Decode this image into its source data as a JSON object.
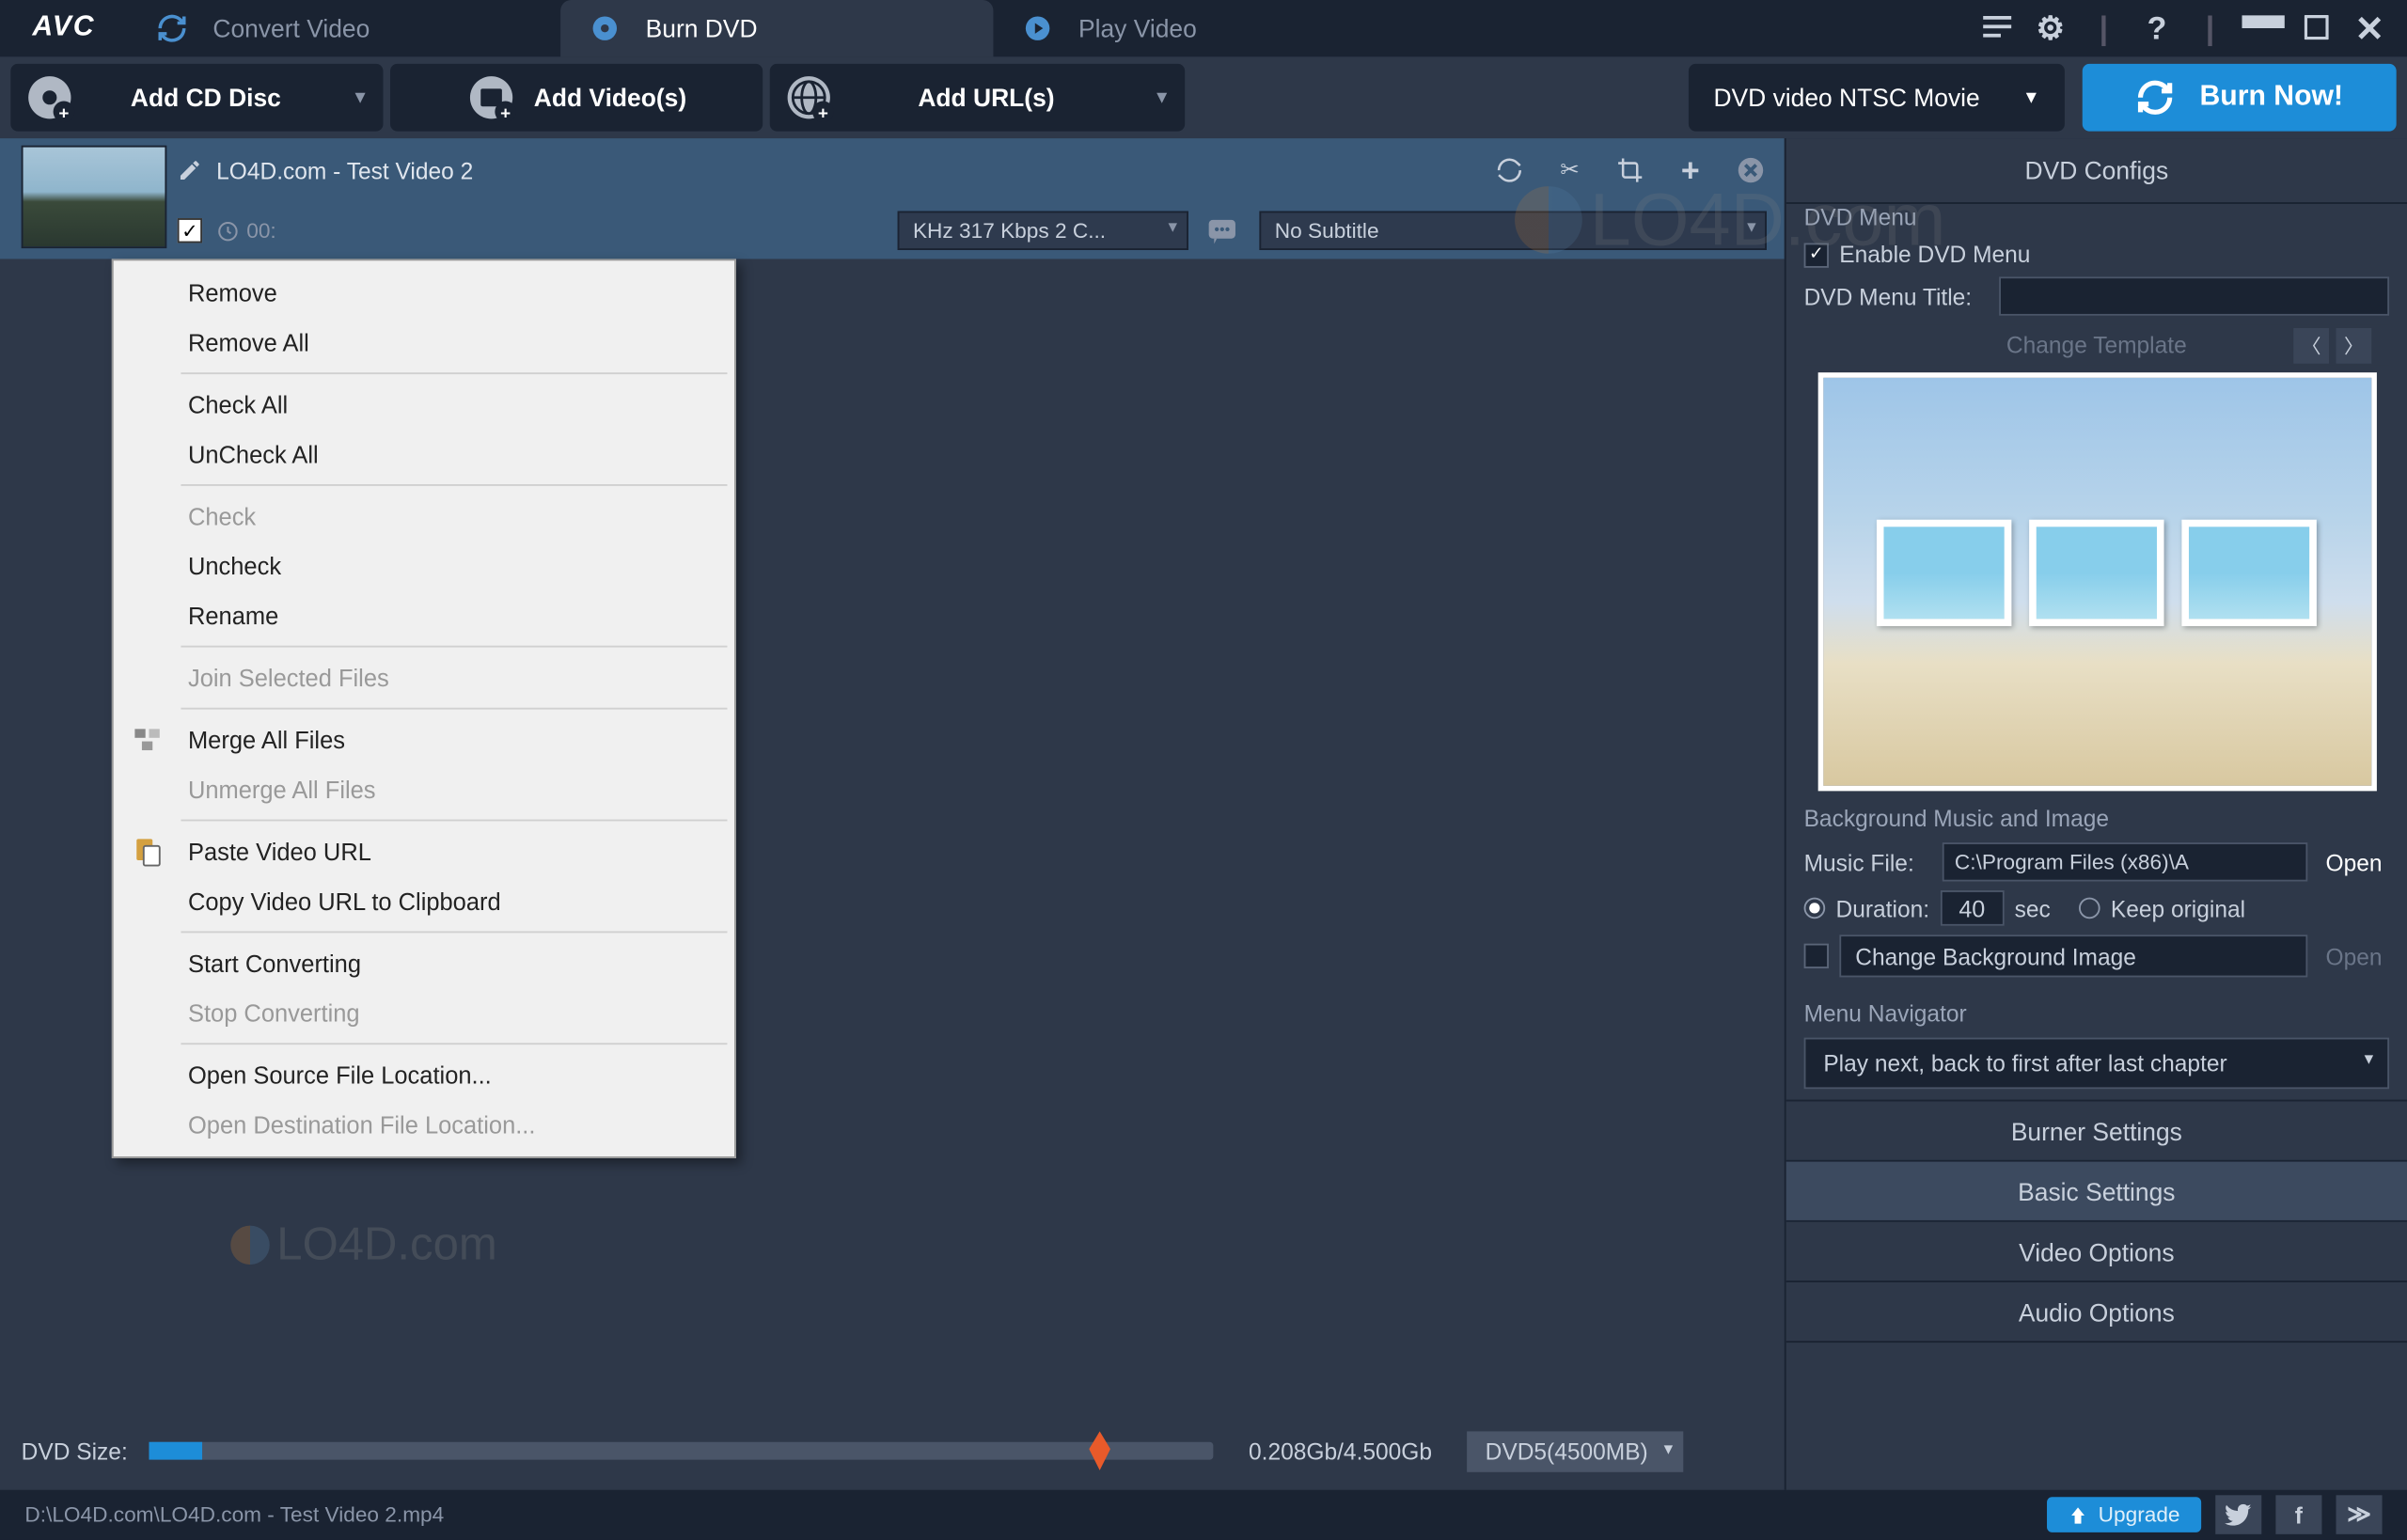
{
  "logo": "AVC",
  "tabs": [
    {
      "label": "Convert Video",
      "active": false
    },
    {
      "label": "Burn DVD",
      "active": true
    },
    {
      "label": "Play Video",
      "active": false
    }
  ],
  "toolbar": {
    "add_cd": "Add CD Disc",
    "add_videos": "Add Video(s)",
    "add_urls": "Add URL(s)",
    "profile": "DVD video NTSC Movie",
    "burn": "Burn Now!"
  },
  "video": {
    "title": "LO4D.com - Test Video 2",
    "time_partial": "00:",
    "audio_codec": "KHz 317 Kbps 2 C...",
    "subtitle": "No Subtitle"
  },
  "context_menu": [
    {
      "label": "Remove",
      "enabled": true
    },
    {
      "label": "Remove All",
      "enabled": true
    },
    {
      "sep": true
    },
    {
      "label": "Check All",
      "enabled": true
    },
    {
      "label": "UnCheck All",
      "enabled": true
    },
    {
      "sep": true
    },
    {
      "label": "Check",
      "enabled": false
    },
    {
      "label": "Uncheck",
      "enabled": true
    },
    {
      "label": "Rename",
      "enabled": true
    },
    {
      "sep": true
    },
    {
      "label": "Join Selected Files",
      "enabled": false
    },
    {
      "sep": true
    },
    {
      "label": "Merge All Files",
      "enabled": true,
      "icon": "merge"
    },
    {
      "label": "Unmerge All Files",
      "enabled": false
    },
    {
      "sep": true
    },
    {
      "label": "Paste Video URL",
      "enabled": true,
      "icon": "paste"
    },
    {
      "label": "Copy Video URL to Clipboard",
      "enabled": true
    },
    {
      "sep": true
    },
    {
      "label": "Start Converting",
      "enabled": true
    },
    {
      "label": "Stop Converting",
      "enabled": false
    },
    {
      "sep": true
    },
    {
      "label": "Open Source File Location...",
      "enabled": true
    },
    {
      "label": "Open Destination File Location...",
      "enabled": false
    }
  ],
  "dvd_size": {
    "label": "DVD Size:",
    "text": "0.208Gb/4.500Gb",
    "preset": "DVD5(4500MB)"
  },
  "right": {
    "config_title": "DVD Configs",
    "dvd_menu": "DVD Menu",
    "enable_menu": "Enable DVD Menu",
    "menu_title_label": "DVD Menu Title:",
    "menu_title_value": "",
    "change_template": "Change Template",
    "bg_section": "Background Music and Image",
    "music_label": "Music File:",
    "music_value": "C:\\Program Files (x86)\\A",
    "open": "Open",
    "duration_label": "Duration:",
    "duration_value": "40",
    "sec": "sec",
    "keep_original": "Keep original",
    "change_bg": "Change Background Image",
    "nav_label": "Menu Navigator",
    "nav_value": "Play next, back to first after last chapter",
    "acc": [
      "Burner Settings",
      "Basic Settings",
      "Video Options",
      "Audio Options"
    ]
  },
  "status": {
    "path": "D:\\LO4D.com\\LO4D.com - Test Video 2.mp4",
    "upgrade": "Upgrade"
  },
  "watermark": "LO4D.com"
}
